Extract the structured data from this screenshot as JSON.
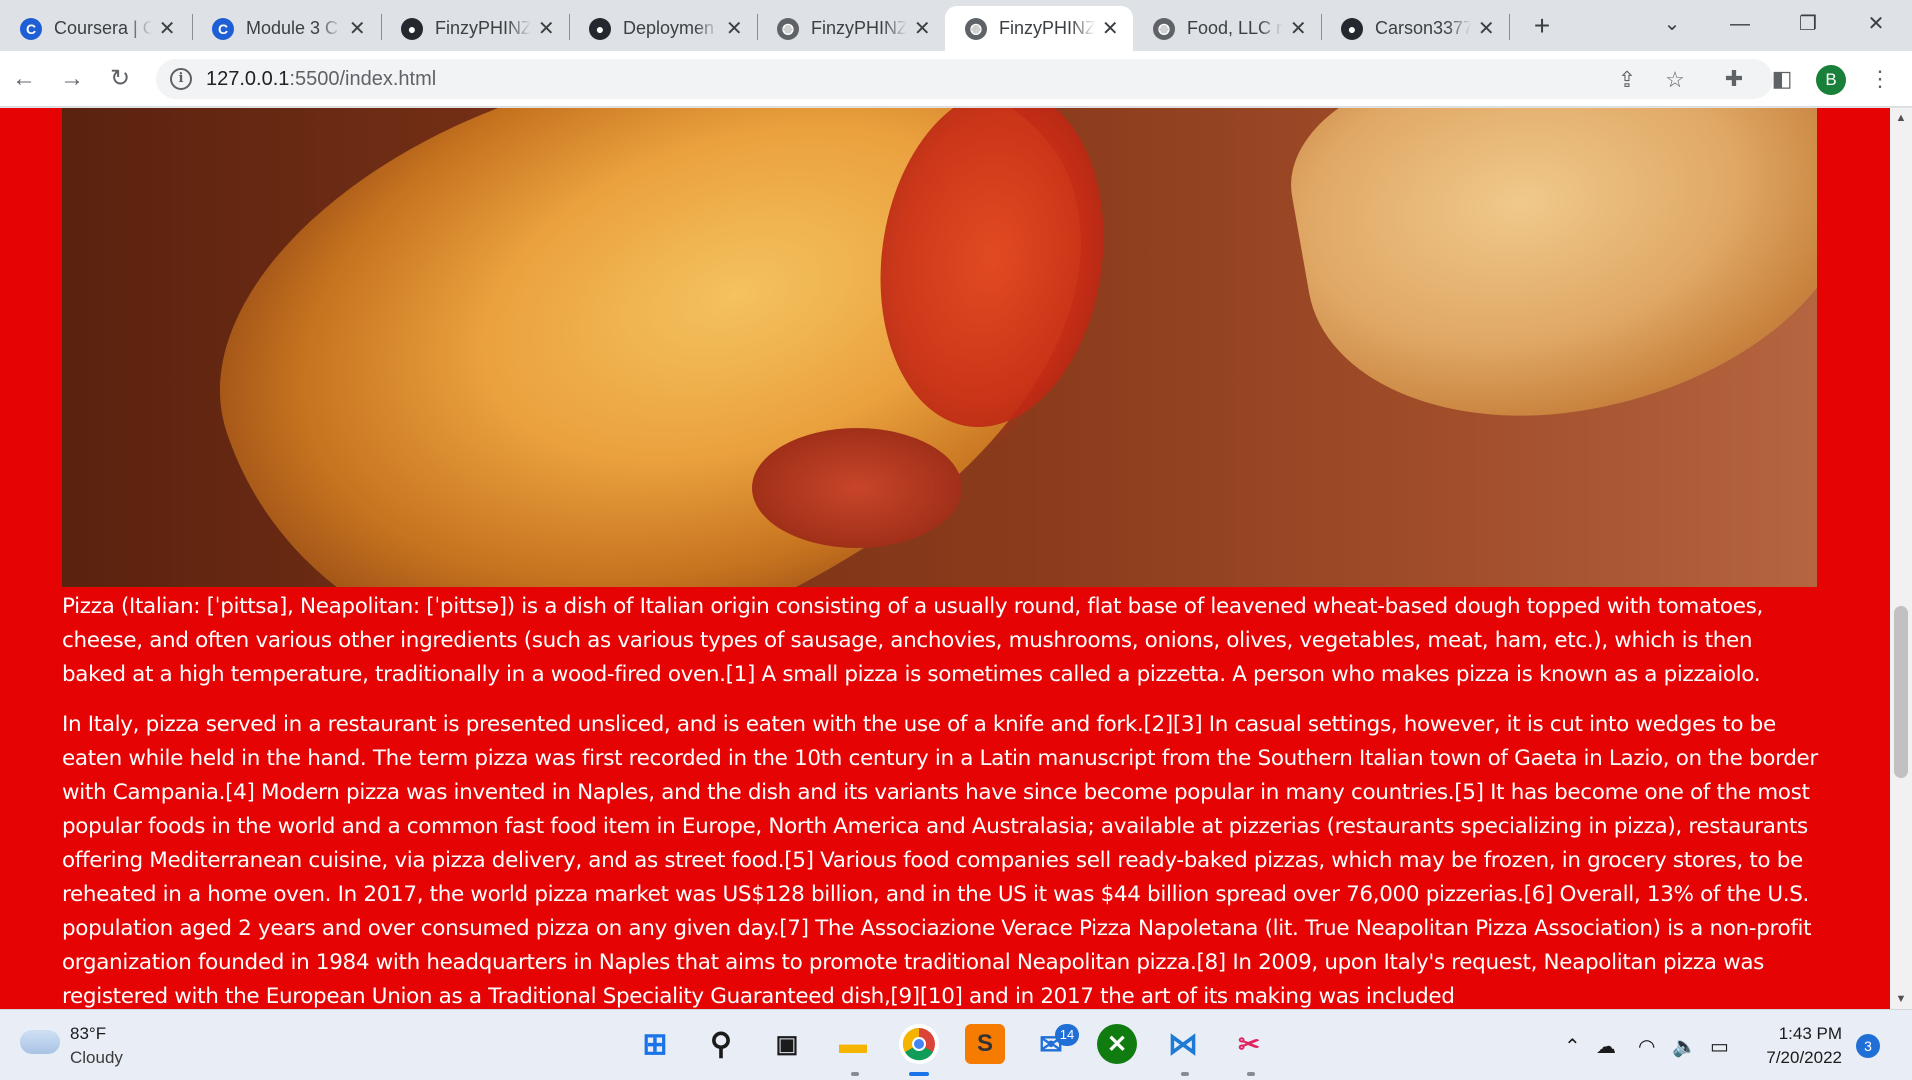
{
  "browser": {
    "tabs": [
      {
        "title": "Coursera | C",
        "favicon": "coursera-icon",
        "active": false
      },
      {
        "title": "Module 3 C",
        "favicon": "coursera-icon",
        "active": false
      },
      {
        "title": "FinzyPHINZ",
        "favicon": "github-icon",
        "active": false
      },
      {
        "title": "Deploymen",
        "favicon": "github-icon",
        "active": false
      },
      {
        "title": "FinzyPHINZ",
        "favicon": "globe-icon",
        "active": false
      },
      {
        "title": "FinzyPHINZ",
        "favicon": "globe-icon",
        "active": true
      },
      {
        "title": "Food, LLC r",
        "favicon": "globe-icon",
        "active": false
      },
      {
        "title": "Carson3377",
        "favicon": "github-icon",
        "active": false
      }
    ],
    "url_host": "127.0.0.1",
    "url_rest": ":5500/index.html",
    "profile_initial": "B",
    "accent": "#1a73e8"
  },
  "page": {
    "background_color": "#e50303",
    "hero_image": "pizza-photo",
    "paragraphs": [
      "Pizza (Italian: [ˈpittsa], Neapolitan: [ˈpittsə]) is a dish of Italian origin consisting of a usually round, flat base of leavened wheat-based dough topped with tomatoes, cheese, and often various other ingredients (such as various types of sausage, anchovies, mushrooms, onions, olives, vegetables, meat, ham, etc.), which is then baked at a high temperature, traditionally in a wood-fired oven.[1] A small pizza is sometimes called a pizzetta. A person who makes pizza is known as a pizzaiolo.",
      "In Italy, pizza served in a restaurant is presented unsliced, and is eaten with the use of a knife and fork.[2][3] In casual settings, however, it is cut into wedges to be eaten while held in the hand. The term pizza was first recorded in the 10th century in a Latin manuscript from the Southern Italian town of Gaeta in Lazio, on the border with Campania.[4] Modern pizza was invented in Naples, and the dish and its variants have since become popular in many countries.[5] It has become one of the most popular foods in the world and a common fast food item in Europe, North America and Australasia; available at pizzerias (restaurants specializing in pizza), restaurants offering Mediterranean cuisine, via pizza delivery, and as street food.[5] Various food companies sell ready-baked pizzas, which may be frozen, in grocery stores, to be reheated in a home oven. In 2017, the world pizza market was US$128 billion, and in the US it was $44 billion spread over 76,000 pizzerias.[6] Overall, 13% of the U.S. population aged 2 years and over consumed pizza on any given day.[7] The Associazione Verace Pizza Napoletana (lit. True Neapolitan Pizza Association) is a non-profit organization founded in 1984 with headquarters in Naples that aims to promote traditional Neapolitan pizza.[8] In 2009, upon Italy's request, Neapolitan pizza was registered with the European Union as a Traditional Speciality Guaranteed dish,[9][10] and in 2017 the art of its making was included"
    ]
  },
  "taskbar": {
    "weather_temp": "83°F",
    "weather_desc": "Cloudy",
    "mail_badge": "14",
    "time": "1:43 PM",
    "date": "7/20/2022",
    "notification_count": "3"
  }
}
